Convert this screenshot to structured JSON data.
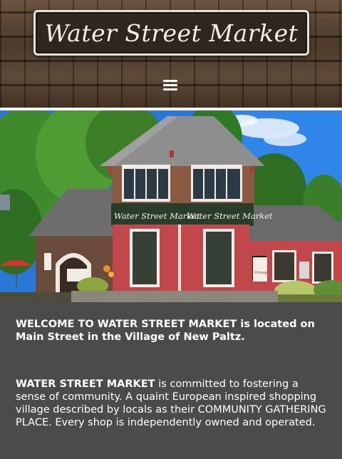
{
  "header": {
    "logo_text": "Water Street Market",
    "menu_icon": "hamburger-menu-icon"
  },
  "hero": {
    "sign_left": "Water Street Market",
    "sign_right": "Water Street Market",
    "window_sign": "Vintage"
  },
  "content": {
    "paragraph1": "WELCOME TO WATER STREET MARKET is located on Main Street in the Village of New Paltz.",
    "paragraph2_lead": "WATER STREET MARKET",
    "paragraph2_rest": " is committed to fostering a sense of community. A quaint European inspired shopping village described by locals as their COMMUNITY GATHERING PLACE. Every shop is independently owned and operated."
  },
  "colors": {
    "background": "#4b4b4b",
    "text": "#ffffff",
    "sign_dark": "#2e2620",
    "building_red": "#c2474a"
  }
}
